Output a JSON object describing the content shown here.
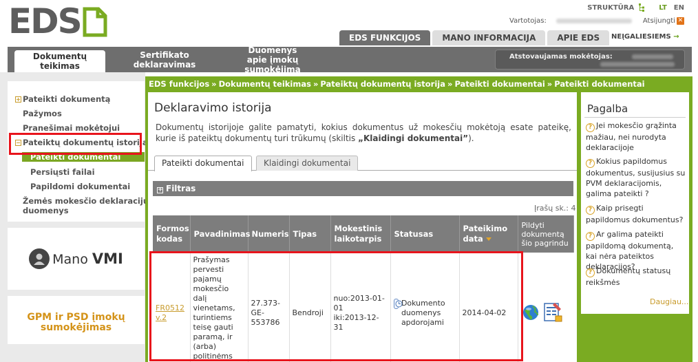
{
  "header": {
    "logo_text": "EDS",
    "structure_link": "STRUKTŪRA",
    "lang_lt": "LT",
    "lang_en": "EN",
    "user_label": "Vartotojas:",
    "logout": "Atsijungti",
    "top_tabs": [
      "EDS FUNKCIJOS",
      "MANO INFORMACIJA",
      "APIE EDS"
    ],
    "disabled_link": "NEĮGALIESIEMS",
    "arrow": "→"
  },
  "navbar": {
    "tabs": [
      "Dokumentų teikimas",
      "Sertifikato deklaravimas",
      "Duomenys apie įmokų sumokėjimą"
    ],
    "tab3_line1": "Duomenys",
    "tab3_line2": "apie įmokų sumokėjimą",
    "represented_label": "Atstovaujamas mokėtojas:"
  },
  "sidebar": {
    "items": [
      {
        "label": "Pateikti dokumentą",
        "plus": "+"
      },
      {
        "label": "Pažymos"
      },
      {
        "label": "Pranešimai mokėtojui"
      },
      {
        "label": "Pateiktų dokumentų istorija",
        "plus": "−"
      },
      {
        "label": "Pateikti dokumentai"
      },
      {
        "label": "Persiųsti failai"
      },
      {
        "label": "Papildomi dokumentai"
      },
      {
        "label": "Žemės mokesčio deklaracijų"
      },
      {
        "label": "duomenys"
      }
    ],
    "mano_vmi_1": "Mano",
    "mano_vmi_2": "VMI",
    "gpm_line1": "GPM ir PSD įmokų",
    "gpm_line2": "sumokėjimas"
  },
  "breadcrumb": [
    "EDS funkcijos",
    "Dokumentų teikimas",
    "Pateiktų dokumentų istorija",
    "Pateikti dokumentai",
    "Pateikti dokumentai"
  ],
  "breadcrumb_sep": "»",
  "main": {
    "title": "Deklaravimo istorija",
    "desc_prefix": "Dokumentų istorijoje galite pamatyti, kokius dokumentus už mokesčių mokėtoją esate pateikę, kurie iš pateiktų dokumentų turi trūkumų (skiltis ",
    "desc_bold": "„Klaidingi dokumentai”",
    "desc_suffix": ").",
    "tabs": [
      "Pateikti dokumentai",
      "Klaidingi dokumentai"
    ],
    "filter_label": "Filtras",
    "filter_plus": "+",
    "count_text": "Įrašų sk.: 4"
  },
  "table": {
    "headers": [
      "Formos kodas",
      "Pavadinimas",
      "Numeris",
      "Tipas",
      "Mokestinis laikotarpis",
      "Statusas",
      "Pateikimo data",
      "Pildyti dokumentą šio pagrindu"
    ],
    "row": {
      "form_code": "FR0512 v.2",
      "name": "Prašymas pervesti pajamų mokesčio dalį vienetams, turintiems teisę gauti paramą, ir (arba) politinėms partijoms",
      "number": "27.373-GE-553786",
      "type": "Bendroji",
      "period_from": "nuo:2013-01-01",
      "period_to": "iki:2013-12-31",
      "status": "Dokumento duomenys apdorojami",
      "date": "2014-04-02"
    }
  },
  "help": {
    "title": "Pagalba",
    "items": [
      "Jei mokesčio grąžinta mažiau, nei nurodyta deklaracijoje",
      "Kokius papildomus dokumentus, susijusius su PVM deklaracijomis, galima pateikti ?",
      "Kaip prisegti papildomus dokumentus?",
      "Ar galima pateikti papildomą dokumentą, kai nėra pateiktos deklaracijos?",
      "Dokumentų statusų reikšmės"
    ],
    "more": "Daugiau...",
    "q": "?"
  },
  "colors": {
    "green": "#7aab22",
    "gray": "#6e6e6e",
    "red_highlight": "#e8141c",
    "gold_link": "#c89b2b"
  }
}
